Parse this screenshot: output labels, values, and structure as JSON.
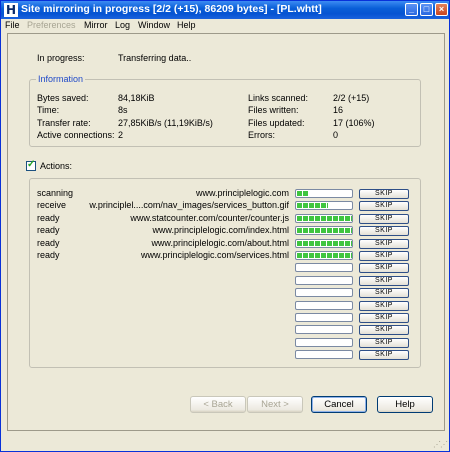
{
  "window": {
    "title": "Site mirroring in progress [2/2 (+15), 86209 bytes] - [PL.whtt]",
    "app_icon_letter": "H",
    "controls": {
      "minimize": "_",
      "maximize": "□",
      "close": "×"
    }
  },
  "menu": [
    "File",
    "Preferences",
    "Mirror",
    "Log",
    "Window",
    "Help"
  ],
  "status": {
    "label": "In progress:",
    "value": "Transferring data.."
  },
  "info": {
    "title": "Information",
    "left": [
      {
        "label": "Bytes saved:",
        "value": "84,18KiB"
      },
      {
        "label": "Time:",
        "value": "8s"
      },
      {
        "label": "Transfer rate:",
        "value": "27,85KiB/s (11,19KiB/s)"
      },
      {
        "label": "Active connections:",
        "value": "2"
      }
    ],
    "right": [
      {
        "label": "Links scanned:",
        "value": "2/2 (+15)"
      },
      {
        "label": "Files written:",
        "value": "16"
      },
      {
        "label": "Files updated:",
        "value": "17 (106%)"
      },
      {
        "label": "Errors:",
        "value": "0"
      }
    ]
  },
  "actions": {
    "label": "Actions:",
    "checked": true,
    "skip_label": "SKIP",
    "rows": [
      {
        "status": "scanning",
        "url": "www.principlelogic.com",
        "progress": 0.22
      },
      {
        "status": "receive",
        "url": "w.principlel....com/nav_images/services_button.gif",
        "progress": 0.55
      },
      {
        "status": "ready",
        "url": "www.statcounter.com/counter/counter.js",
        "progress": 1.0
      },
      {
        "status": "ready",
        "url": "www.principlelogic.com/index.html",
        "progress": 1.0
      },
      {
        "status": "ready",
        "url": "www.principlelogic.com/about.html",
        "progress": 1.0
      },
      {
        "status": "ready",
        "url": "www.principlelogic.com/services.html",
        "progress": 1.0
      },
      {
        "status": "",
        "url": "",
        "progress": 0
      },
      {
        "status": "",
        "url": "",
        "progress": 0
      },
      {
        "status": "",
        "url": "",
        "progress": 0
      },
      {
        "status": "",
        "url": "",
        "progress": 0
      },
      {
        "status": "",
        "url": "",
        "progress": 0
      },
      {
        "status": "",
        "url": "",
        "progress": 0
      },
      {
        "status": "",
        "url": "",
        "progress": 0
      },
      {
        "status": "",
        "url": "",
        "progress": 0
      }
    ]
  },
  "buttons": {
    "back": "< Back",
    "next": "Next >",
    "cancel": "Cancel",
    "help": "Help"
  },
  "colors": {
    "progress_fill": "#3fc53f",
    "group_title": "#1f49c8",
    "titlebar": "#0553d2"
  }
}
